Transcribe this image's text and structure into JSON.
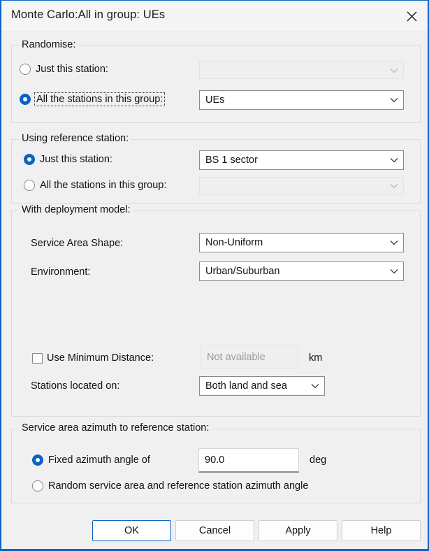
{
  "window": {
    "title": "Monte Carlo:All in group: UEs",
    "close_icon": "close-icon",
    "accent_color": "#0b63c5"
  },
  "groups": {
    "randomise": {
      "legend": "Randomise:",
      "options": [
        {
          "label": "Just this station:",
          "selected": false,
          "focused": false
        },
        {
          "label": "All the stations in this group:",
          "selected": true,
          "focused": true
        }
      ],
      "combo_just_station": {
        "value": "",
        "enabled": false
      },
      "combo_all_group": {
        "value": "UEs",
        "enabled": true
      }
    },
    "reference_station": {
      "legend": "Using reference station:",
      "options": [
        {
          "label": "Just this station:",
          "selected": true,
          "focused": false
        },
        {
          "label": "All the stations in this group:",
          "selected": false,
          "focused": false
        }
      ],
      "combo_just_station": {
        "value": "BS 1 sector",
        "enabled": true
      },
      "combo_all_group": {
        "value": "",
        "enabled": false
      }
    },
    "deployment_model": {
      "legend": "With deployment model:",
      "service_area_shape_label": "Service Area Shape:",
      "service_area_shape_value": "Non-Uniform",
      "environment_label": "Environment:",
      "environment_value": "Urban/Suburban",
      "use_min_distance_label": "Use Minimum Distance:",
      "use_min_distance_checked": false,
      "min_distance_value": "Not available",
      "min_distance_enabled": false,
      "min_distance_unit": "km",
      "stations_located_label": "Stations located on:",
      "stations_located_value": "Both land and sea"
    },
    "azimuth": {
      "legend": "Service area azimuth to reference station:",
      "fixed_label": "Fixed azimuth angle of",
      "fixed_selected": true,
      "fixed_value": "90.0",
      "fixed_unit": "deg",
      "random_label": "Random service area and reference station azimuth angle",
      "random_selected": false
    }
  },
  "buttons": {
    "ok": "OK",
    "cancel": "Cancel",
    "apply": "Apply",
    "help": "Help"
  }
}
